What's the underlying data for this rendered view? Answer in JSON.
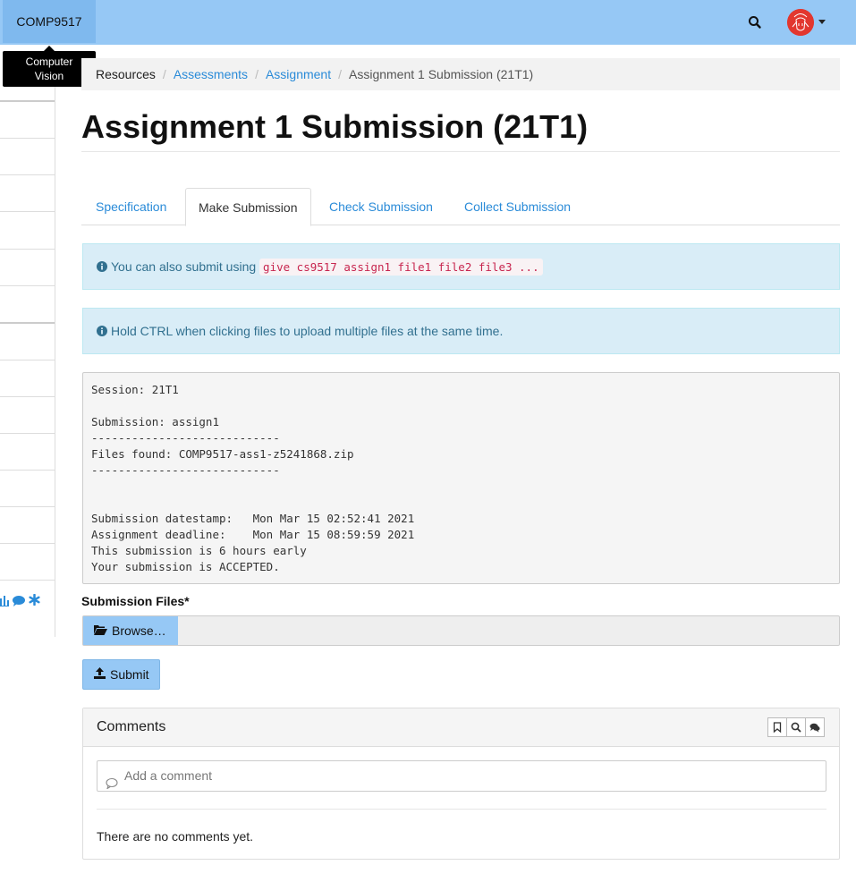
{
  "navbar": {
    "brand": "COMP9517",
    "tooltip_line1": "Computer",
    "tooltip_line2": "Vision",
    "search_icon": "search-icon",
    "avatar_icon": "user-avatar",
    "caret_icon": "chevron-down-icon",
    "bg_color": "#96c8f5"
  },
  "breadcrumb": {
    "items": [
      {
        "label": "Resources"
      },
      {
        "label": "Assessments"
      },
      {
        "label": "Assignment"
      },
      {
        "label": "Assignment 1 Submission (21T1)"
      }
    ],
    "separator": "/"
  },
  "page": {
    "title": "Assignment 1 Submission (21T1)"
  },
  "tabs": [
    {
      "label": "Specification",
      "active": false
    },
    {
      "label": "Make Submission",
      "active": true
    },
    {
      "label": "Check Submission",
      "active": false
    },
    {
      "label": "Collect Submission",
      "active": false
    }
  ],
  "alerts": {
    "give_text": "You can also submit using",
    "give_command": "give cs9517 assign1 file1 file2 file3 ...",
    "ctrl_text": "Hold CTRL when clicking files to upload multiple files at the same time."
  },
  "output": {
    "lines": [
      "Session: 21T1",
      "",
      "Submission: assign1",
      "----------------------------",
      "Files found: COMP9517-ass1-z5241868.zip",
      "----------------------------",
      "",
      "",
      "Submission datestamp:   Mon Mar 15 02:52:41 2021",
      "Assignment deadline:    Mon Mar 15 08:59:59 2021",
      "This submission is 6 hours early",
      "Your submission is ACCEPTED."
    ]
  },
  "form": {
    "files_label": "Submission Files*",
    "browse_label": "Browse…",
    "submit_label": "Submit"
  },
  "comments": {
    "title": "Comments",
    "placeholder": "Add a comment",
    "empty_text": "There are no comments yet."
  }
}
